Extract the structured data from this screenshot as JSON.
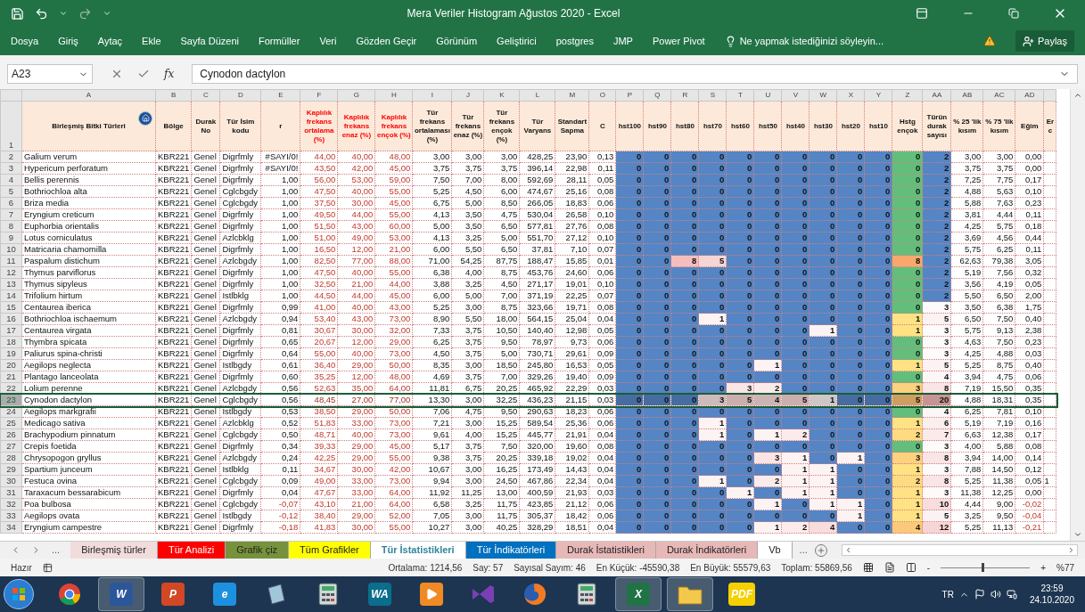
{
  "window": {
    "title": "Mera Veriler Histogram Ağustos 2020 - Excel"
  },
  "menu": [
    "Dosya",
    "Giriş",
    "Aytaç",
    "Ekle",
    "Sayfa Düzeni",
    "Formüller",
    "Veri",
    "Gözden Geçir",
    "Görünüm",
    "Geliştirici",
    "postgres",
    "JMP",
    "Power Pivot"
  ],
  "tell_me": {
    "placeholder": "Ne yapmak istediğinizi söyleyin..."
  },
  "share": "Paylaş",
  "formula_bar": {
    "name_box": "A23",
    "fx": "fx",
    "value": "Cynodon dactylon"
  },
  "header_row_number": "1",
  "columns": [
    {
      "letter": "A",
      "title": "Birleşmiş Bitki Türleri",
      "kind": "name"
    },
    {
      "letter": "B",
      "title": "Bölge",
      "kind": "text"
    },
    {
      "letter": "C",
      "title": "Durak No",
      "kind": "text"
    },
    {
      "letter": "D",
      "title": "Tür İsim kodu",
      "kind": "text"
    },
    {
      "letter": "E",
      "title": "r",
      "kind": "number"
    },
    {
      "letter": "F",
      "title": "Kaplılık frekans ortalama (%)",
      "kind": "frequency",
      "color": "#ff0000"
    },
    {
      "letter": "G",
      "title": "Kaplılık frekans enaz (%)",
      "kind": "frequency",
      "color": "#ff0000"
    },
    {
      "letter": "H",
      "title": "Kaplılık frekans ençok (%)",
      "kind": "frequency",
      "color": "#ff0000"
    },
    {
      "letter": "I",
      "title": "Tür frekans ortalaması (%)",
      "kind": "number"
    },
    {
      "letter": "J",
      "title": "Tür frekans enaz (%)",
      "kind": "number"
    },
    {
      "letter": "K",
      "title": "Tür frekans ençok (%)",
      "kind": "number"
    },
    {
      "letter": "L",
      "title": "Tür Varyans",
      "kind": "number"
    },
    {
      "letter": "M",
      "title": "Standart Sapma",
      "kind": "number"
    },
    {
      "letter": "O",
      "title": "C",
      "kind": "number"
    },
    {
      "letter": "P",
      "title": "hst100",
      "kind": "histogram"
    },
    {
      "letter": "Q",
      "title": "hst90",
      "kind": "histogram"
    },
    {
      "letter": "R",
      "title": "hst80",
      "kind": "histogram"
    },
    {
      "letter": "S",
      "title": "hst70",
      "kind": "histogram"
    },
    {
      "letter": "T",
      "title": "hst60",
      "kind": "histogram"
    },
    {
      "letter": "U",
      "title": "hst50",
      "kind": "histogram"
    },
    {
      "letter": "V",
      "title": "hst40",
      "kind": "histogram"
    },
    {
      "letter": "W",
      "title": "hst30",
      "kind": "histogram"
    },
    {
      "letter": "X",
      "title": "hst20",
      "kind": "histogram"
    },
    {
      "letter": "Y",
      "title": "hst10",
      "kind": "histogram"
    },
    {
      "letter": "Z",
      "title": "Hstg ençok",
      "kind": "peak"
    },
    {
      "letter": "AA",
      "title": "Türün durak sayısı",
      "kind": "count"
    },
    {
      "letter": "AB",
      "title": "% 25 'lik kısım",
      "kind": "number"
    },
    {
      "letter": "AC",
      "title": "% 75 'lik kısım",
      "kind": "number"
    },
    {
      "letter": "AD",
      "title": "Eğim",
      "kind": "number"
    },
    {
      "title": "Er c",
      "kind": "cut"
    }
  ],
  "rows": [
    {
      "number": "2",
      "selected": false,
      "cells": [
        "Galium verum",
        "KBR221",
        "Genel",
        "Digrfmly",
        "#SAYI/0!",
        "44,00",
        "40,00",
        "48,00",
        "3,00",
        "3,00",
        "3,00",
        "428,25",
        "23,90",
        "0,13",
        "0",
        "0",
        "0",
        "0",
        "0",
        "0",
        "0",
        "0",
        "0",
        "0",
        "0",
        "2",
        "3,00",
        "3,00",
        "0,00"
      ]
    },
    {
      "number": "3",
      "selected": false,
      "cells": [
        "Hypericum perforatum",
        "KBR221",
        "Genel",
        "Digrfmly",
        "#SAYI/0!",
        "43,50",
        "42,00",
        "45,00",
        "3,75",
        "3,75",
        "3,75",
        "396,14",
        "22,98",
        "0,11",
        "0",
        "0",
        "0",
        "0",
        "0",
        "0",
        "0",
        "0",
        "0",
        "0",
        "0",
        "2",
        "3,75",
        "3,75",
        "0,00"
      ]
    },
    {
      "number": "4",
      "selected": false,
      "cells": [
        "Bellis perennis",
        "KBR221",
        "Genel",
        "Digrfmly",
        "1,00",
        "56,00",
        "53,00",
        "59,00",
        "7,50",
        "7,00",
        "8,00",
        "592,69",
        "28,11",
        "0,05",
        "0",
        "0",
        "0",
        "0",
        "0",
        "0",
        "0",
        "0",
        "0",
        "0",
        "0",
        "2",
        "7,25",
        "7,75",
        "0,17"
      ]
    },
    {
      "number": "5",
      "selected": false,
      "cells": [
        "Bothriochloa alta",
        "KBR221",
        "Genel",
        "Cglcbgdy",
        "1,00",
        "47,50",
        "40,00",
        "55,00",
        "5,25",
        "4,50",
        "6,00",
        "474,67",
        "25,16",
        "0,08",
        "0",
        "0",
        "0",
        "0",
        "0",
        "0",
        "0",
        "0",
        "0",
        "0",
        "0",
        "2",
        "4,88",
        "5,63",
        "0,10"
      ]
    },
    {
      "number": "6",
      "selected": false,
      "cells": [
        "Briza media",
        "KBR221",
        "Genel",
        "Cglcbgdy",
        "1,00",
        "37,50",
        "30,00",
        "45,00",
        "6,75",
        "5,00",
        "8,50",
        "266,05",
        "18,83",
        "0,06",
        "0",
        "0",
        "0",
        "0",
        "0",
        "0",
        "0",
        "0",
        "0",
        "0",
        "0",
        "2",
        "5,88",
        "7,63",
        "0,23"
      ]
    },
    {
      "number": "7",
      "selected": false,
      "cells": [
        "Eryngium creticum",
        "KBR221",
        "Genel",
        "Digrfmly",
        "1,00",
        "49,50",
        "44,00",
        "55,00",
        "4,13",
        "3,50",
        "4,75",
        "530,04",
        "26,58",
        "0,10",
        "0",
        "0",
        "0",
        "0",
        "0",
        "0",
        "0",
        "0",
        "0",
        "0",
        "0",
        "2",
        "3,81",
        "4,44",
        "0,11"
      ]
    },
    {
      "number": "8",
      "selected": false,
      "cells": [
        "Euphorbia orientalis",
        "KBR221",
        "Genel",
        "Digrfmly",
        "1,00",
        "51,50",
        "43,00",
        "60,00",
        "5,00",
        "3,50",
        "6,50",
        "577,81",
        "27,76",
        "0,08",
        "0",
        "0",
        "0",
        "0",
        "0",
        "0",
        "0",
        "0",
        "0",
        "0",
        "0",
        "2",
        "4,25",
        "5,75",
        "0,18"
      ]
    },
    {
      "number": "9",
      "selected": false,
      "cells": [
        "Lotus corniculatus",
        "KBR221",
        "Genel",
        "Azlcbklg",
        "1,00",
        "51,00",
        "49,00",
        "53,00",
        "4,13",
        "3,25",
        "5,00",
        "551,70",
        "27,12",
        "0,10",
        "0",
        "0",
        "0",
        "0",
        "0",
        "0",
        "0",
        "0",
        "0",
        "0",
        "0",
        "2",
        "3,69",
        "4,56",
        "0,44"
      ]
    },
    {
      "number": "10",
      "selected": false,
      "cells": [
        "Matricaria chamomilla",
        "KBR221",
        "Genel",
        "Digrfmly",
        "1,00",
        "16,50",
        "12,00",
        "21,00",
        "6,00",
        "5,50",
        "6,50",
        "37,81",
        "7,10",
        "0,07",
        "0",
        "0",
        "0",
        "0",
        "0",
        "0",
        "0",
        "0",
        "0",
        "0",
        "0",
        "2",
        "5,75",
        "6,25",
        "0,11"
      ]
    },
    {
      "number": "11",
      "selected": false,
      "cells": [
        "Paspalum distichum",
        "KBR221",
        "Genel",
        "Azlcbgdy",
        "1,00",
        "82,50",
        "77,00",
        "88,00",
        "71,00",
        "54,25",
        "87,75",
        "188,47",
        "15,85",
        "0,01",
        "0",
        "0",
        "8",
        "5",
        "0",
        "0",
        "0",
        "0",
        "0",
        "0",
        "8",
        "2",
        "62,63",
        "79,38",
        "3,05"
      ]
    },
    {
      "number": "12",
      "selected": false,
      "cells": [
        "Thymus parviflorus",
        "KBR221",
        "Genel",
        "Digrfmly",
        "1,00",
        "47,50",
        "40,00",
        "55,00",
        "6,38",
        "4,00",
        "8,75",
        "453,76",
        "24,60",
        "0,06",
        "0",
        "0",
        "0",
        "0",
        "0",
        "0",
        "0",
        "0",
        "0",
        "0",
        "0",
        "2",
        "5,19",
        "7,56",
        "0,32"
      ]
    },
    {
      "number": "13",
      "selected": false,
      "cells": [
        "Thymus sipyleus",
        "KBR221",
        "Genel",
        "Digrfmly",
        "1,00",
        "32,50",
        "21,00",
        "44,00",
        "3,88",
        "3,25",
        "4,50",
        "271,17",
        "19,01",
        "0,10",
        "0",
        "0",
        "0",
        "0",
        "0",
        "0",
        "0",
        "0",
        "0",
        "0",
        "0",
        "2",
        "3,56",
        "4,19",
        "0,05"
      ]
    },
    {
      "number": "14",
      "selected": false,
      "cells": [
        "Trifolium hirtum",
        "KBR221",
        "Genel",
        "Istlbklg",
        "1,00",
        "44,50",
        "44,00",
        "45,00",
        "6,00",
        "5,00",
        "7,00",
        "371,19",
        "22,25",
        "0,07",
        "0",
        "0",
        "0",
        "0",
        "0",
        "0",
        "0",
        "0",
        "0",
        "0",
        "0",
        "2",
        "5,50",
        "6,50",
        "2,00"
      ]
    },
    {
      "number": "15",
      "selected": false,
      "cells": [
        "Centaurea iberica",
        "KBR221",
        "Genel",
        "Digrfmly",
        "0,99",
        "41,00",
        "40,00",
        "43,00",
        "5,25",
        "3,00",
        "8,75",
        "323,66",
        "19,71",
        "0,08",
        "0",
        "0",
        "0",
        "0",
        "0",
        "0",
        "0",
        "0",
        "0",
        "0",
        "0",
        "3",
        "3,50",
        "6,38",
        "1,75"
      ]
    },
    {
      "number": "16",
      "selected": false,
      "cells": [
        "Bothriochloa ischaemum",
        "KBR221",
        "Genel",
        "Azlcbgdy",
        "0,94",
        "53,40",
        "43,00",
        "73,00",
        "8,90",
        "5,50",
        "18,00",
        "564,15",
        "25,04",
        "0,04",
        "0",
        "0",
        "0",
        "1",
        "0",
        "0",
        "0",
        "0",
        "0",
        "0",
        "1",
        "5",
        "6,50",
        "7,50",
        "0,40"
      ]
    },
    {
      "number": "17",
      "selected": false,
      "cells": [
        "Centaurea virgata",
        "KBR221",
        "Genel",
        "Digrfmly",
        "0,81",
        "30,67",
        "30,00",
        "32,00",
        "7,33",
        "3,75",
        "10,50",
        "140,40",
        "12,98",
        "0,05",
        "0",
        "0",
        "0",
        "0",
        "0",
        "0",
        "0",
        "1",
        "0",
        "0",
        "1",
        "3",
        "5,75",
        "9,13",
        "2,38"
      ]
    },
    {
      "number": "18",
      "selected": false,
      "cells": [
        "Thymbra spicata",
        "KBR221",
        "Genel",
        "Digrfmly",
        "0,65",
        "20,67",
        "12,00",
        "29,00",
        "6,25",
        "3,75",
        "9,50",
        "78,97",
        "9,73",
        "0,06",
        "0",
        "0",
        "0",
        "0",
        "0",
        "0",
        "0",
        "0",
        "0",
        "0",
        "0",
        "3",
        "4,63",
        "7,50",
        "0,23"
      ]
    },
    {
      "number": "19",
      "selected": false,
      "cells": [
        "Paliurus spina-christi",
        "KBR221",
        "Genel",
        "Digrfmly",
        "0,64",
        "55,00",
        "40,00",
        "73,00",
        "4,50",
        "3,75",
        "5,00",
        "730,71",
        "29,61",
        "0,09",
        "0",
        "0",
        "0",
        "0",
        "0",
        "0",
        "0",
        "0",
        "0",
        "0",
        "0",
        "3",
        "4,25",
        "4,88",
        "0,03"
      ]
    },
    {
      "number": "20",
      "selected": false,
      "cells": [
        "Aegilops neglecta",
        "KBR221",
        "Genel",
        "Istlbgdy",
        "0,61",
        "36,40",
        "29,00",
        "50,00",
        "8,35",
        "3,00",
        "18,50",
        "245,80",
        "16,53",
        "0,05",
        "0",
        "0",
        "0",
        "0",
        "0",
        "1",
        "0",
        "0",
        "0",
        "0",
        "1",
        "5",
        "5,25",
        "8,75",
        "0,40"
      ]
    },
    {
      "number": "21",
      "selected": false,
      "cells": [
        "Plantago lanceolata",
        "KBR221",
        "Genel",
        "Digrfmly",
        "0,60",
        "35,25",
        "12,00",
        "48,00",
        "4,69",
        "3,75",
        "7,00",
        "329,26",
        "19,40",
        "0,09",
        "0",
        "0",
        "0",
        "0",
        "0",
        "0",
        "0",
        "0",
        "0",
        "0",
        "0",
        "4",
        "3,94",
        "4,75",
        "0,06"
      ]
    },
    {
      "number": "22",
      "selected": false,
      "cells": [
        "Lolium perenne",
        "KBR221",
        "Genel",
        "Azlcbgdy",
        "0,56",
        "52,63",
        "35,00",
        "64,00",
        "11,81",
        "6,75",
        "20,25",
        "465,92",
        "22,29",
        "0,03",
        "0",
        "0",
        "0",
        "0",
        "3",
        "2",
        "0",
        "0",
        "0",
        "0",
        "3",
        "8",
        "7,19",
        "15,50",
        "0,35"
      ]
    },
    {
      "number": "23",
      "selected": true,
      "cells": [
        "Cynodon dactylon",
        "KBR221",
        "Genel",
        "Cglcbgdy",
        "0,56",
        "48,45",
        "27,00",
        "77,00",
        "13,30",
        "3,00",
        "32,25",
        "436,23",
        "21,15",
        "0,03",
        "0",
        "0",
        "0",
        "3",
        "5",
        "4",
        "5",
        "1",
        "0",
        "0",
        "5",
        "20",
        "4,88",
        "18,31",
        "0,35"
      ]
    },
    {
      "number": "24",
      "selected": false,
      "cells": [
        "Aegilops markgrafii",
        "KBR221",
        "Genel",
        "Istlbgdy",
        "0,53",
        "38,50",
        "29,00",
        "50,00",
        "7,06",
        "4,75",
        "9,50",
        "290,63",
        "18,23",
        "0,06",
        "0",
        "0",
        "0",
        "0",
        "0",
        "0",
        "0",
        "0",
        "0",
        "0",
        "0",
        "4",
        "6,25",
        "7,81",
        "0,10"
      ]
    },
    {
      "number": "25",
      "selected": false,
      "cells": [
        "Medicago sativa",
        "KBR221",
        "Genel",
        "Azlcbklg",
        "0,52",
        "51,83",
        "33,00",
        "73,00",
        "7,21",
        "3,00",
        "15,25",
        "589,54",
        "25,36",
        "0,06",
        "0",
        "0",
        "0",
        "1",
        "0",
        "0",
        "0",
        "0",
        "0",
        "0",
        "1",
        "6",
        "5,19",
        "7,19",
        "0,16"
      ]
    },
    {
      "number": "26",
      "selected": false,
      "cells": [
        "Brachypodium pinnatum",
        "KBR221",
        "Genel",
        "Cglcbgdy",
        "0,50",
        "48,71",
        "40,00",
        "73,00",
        "9,61",
        "4,00",
        "15,25",
        "445,77",
        "21,91",
        "0,04",
        "0",
        "0",
        "0",
        "1",
        "0",
        "1",
        "2",
        "0",
        "0",
        "0",
        "2",
        "7",
        "6,63",
        "12,38",
        "0,17"
      ]
    },
    {
      "number": "27",
      "selected": false,
      "cells": [
        "Crepis foetida",
        "KBR221",
        "Genel",
        "Digrfmly",
        "0,34",
        "39,33",
        "29,00",
        "45,00",
        "5,17",
        "3,75",
        "7,50",
        "320,00",
        "19,60",
        "0,08",
        "0",
        "0",
        "0",
        "0",
        "0",
        "0",
        "0",
        "0",
        "0",
        "0",
        "0",
        "3",
        "4,00",
        "5,88",
        "0,08"
      ]
    },
    {
      "number": "28",
      "selected": false,
      "cells": [
        "Chrysopogon gryllus",
        "KBR221",
        "Genel",
        "Azlcbgdy",
        "0,24",
        "42,25",
        "29,00",
        "55,00",
        "9,38",
        "3,75",
        "20,25",
        "339,18",
        "19,02",
        "0,04",
        "0",
        "0",
        "0",
        "0",
        "0",
        "3",
        "1",
        "0",
        "1",
        "0",
        "3",
        "8",
        "3,94",
        "14,00",
        "0,14"
      ]
    },
    {
      "number": "29",
      "selected": false,
      "cells": [
        "Spartium junceum",
        "KBR221",
        "Genel",
        "Istlbklg",
        "0,11",
        "34,67",
        "30,00",
        "42,00",
        "10,67",
        "3,00",
        "16,25",
        "173,49",
        "14,43",
        "0,04",
        "0",
        "0",
        "0",
        "0",
        "0",
        "0",
        "1",
        "1",
        "0",
        "0",
        "1",
        "3",
        "7,88",
        "14,50",
        "0,12"
      ]
    },
    {
      "number": "30",
      "selected": false,
      "cells": [
        "Festuca ovina",
        "KBR221",
        "Genel",
        "Cglcbgdy",
        "0,09",
        "49,00",
        "33,00",
        "73,00",
        "9,94",
        "3,00",
        "24,50",
        "467,86",
        "22,34",
        "0,04",
        "0",
        "0",
        "0",
        "1",
        "0",
        "2",
        "1",
        "1",
        "0",
        "0",
        "2",
        "8",
        "5,25",
        "11,38",
        "0,05"
      ],
      "extra": "1"
    },
    {
      "number": "31",
      "selected": false,
      "cells": [
        "Taraxacum bessarabicum",
        "KBR221",
        "Genel",
        "Digrfmly",
        "0,04",
        "47,67",
        "33,00",
        "64,00",
        "11,92",
        "11,25",
        "13,00",
        "400,59",
        "21,93",
        "0,03",
        "0",
        "0",
        "0",
        "0",
        "1",
        "0",
        "1",
        "1",
        "0",
        "0",
        "1",
        "3",
        "11,38",
        "12,25",
        "0,00"
      ]
    },
    {
      "number": "32",
      "selected": false,
      "cells": [
        "Poa bulbosa",
        "KBR221",
        "Genel",
        "Cglcbgdy",
        "-0,07",
        "43,10",
        "21,00",
        "64,00",
        "6,58",
        "3,25",
        "11,75",
        "423,85",
        "21,12",
        "0,06",
        "0",
        "0",
        "0",
        "0",
        "0",
        "1",
        "0",
        "1",
        "1",
        "0",
        "1",
        "10",
        "4,44",
        "9,00",
        "-0,02"
      ]
    },
    {
      "number": "33",
      "selected": false,
      "cells": [
        "Aegilops ovata",
        "KBR221",
        "Genel",
        "Istlbgdy",
        "-0,12",
        "38,40",
        "29,00",
        "52,00",
        "7,05",
        "3,00",
        "11,75",
        "305,37",
        "18,42",
        "0,06",
        "0",
        "0",
        "0",
        "0",
        "0",
        "0",
        "0",
        "0",
        "1",
        "0",
        "1",
        "5",
        "3,25",
        "9,50",
        "-0,04"
      ]
    },
    {
      "number": "34",
      "selected": false,
      "cells": [
        "Eryngium campestre",
        "KBR221",
        "Genel",
        "Digrfmly",
        "-0,18",
        "41,83",
        "30,00",
        "55,00",
        "10,27",
        "3,00",
        "40,25",
        "328,29",
        "18,51",
        "0,04",
        "0",
        "0",
        "0",
        "0",
        "0",
        "1",
        "2",
        "4",
        "0",
        "0",
        "4",
        "12",
        "5,25",
        "11,13",
        "-0,21"
      ]
    }
  ],
  "sheet_tabs": [
    {
      "label": "Birleşmiş türler",
      "color": "#f2dcdb",
      "selected": false
    },
    {
      "label": "Tür Analizi",
      "color": "#ff0000",
      "selected": false
    },
    {
      "label": "Grafik çiz",
      "color": "#76923c",
      "selected": false
    },
    {
      "label": "Tüm Grafikler",
      "color": "#ffff00",
      "selected": false
    },
    {
      "label": "Tür İstatistikleri",
      "color": "#31859c",
      "selected": true
    },
    {
      "label": "Tür İndikatörleri",
      "color": "#0070c0",
      "selected": false
    },
    {
      "label": "Durak İstatistikleri",
      "color": "#e6b8b7",
      "selected": false
    },
    {
      "label": "Durak İndikatörleri",
      "color": "#e6b8b7",
      "selected": false
    },
    {
      "label": "Vb",
      "color": "#ffffff",
      "selected": false
    }
  ],
  "tab_more": "...",
  "status_bar": {
    "mode": "Hazır",
    "stats": [
      "Ortalama: 1214,56",
      "Say: 57",
      "Sayısal Sayım: 46",
      "En Küçük: -45590,38",
      "En Büyük: 55579,63",
      "Toplam: 55869,56"
    ],
    "zoom": {
      "minus": "-",
      "plus": "+",
      "value": "%77",
      "level": 0.46
    }
  },
  "taskbar": {
    "apps": [
      {
        "kind": "chrome",
        "active": false
      },
      {
        "kind": "tile",
        "label": "W",
        "color": "#2b579a",
        "active": true
      },
      {
        "kind": "tile",
        "label": "P",
        "color": "#d24726",
        "active": false
      },
      {
        "kind": "tile",
        "label": "e",
        "color": "#1e90e0",
        "active": false
      },
      {
        "kind": "notebook",
        "active": false
      },
      {
        "kind": "calculator",
        "active": false
      },
      {
        "kind": "tile",
        "label": "WA",
        "color": "#0a6e8c",
        "active": false
      },
      {
        "kind": "play",
        "active": false
      },
      {
        "kind": "studio",
        "active": false
      },
      {
        "kind": "firefox",
        "active": false
      },
      {
        "kind": "calculator",
        "active": false
      },
      {
        "kind": "tile",
        "label": "X",
        "color": "#217346",
        "active": true
      },
      {
        "kind": "folder",
        "active": true
      },
      {
        "kind": "tile",
        "label": "PDF",
        "color": "#f5d000",
        "active": false
      }
    ],
    "language": "TR",
    "time": "23:59",
    "date": "24.10.2020"
  }
}
